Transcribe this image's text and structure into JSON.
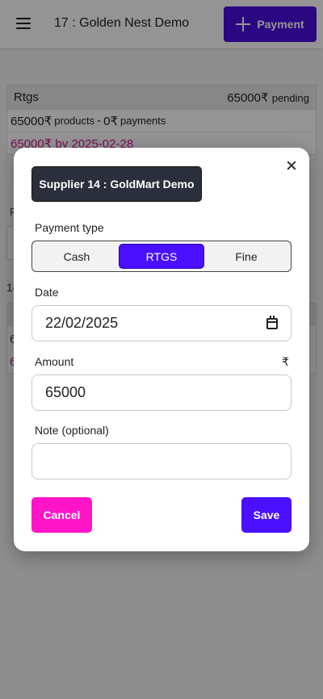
{
  "appbar": {
    "title": "17 : Golden Nest Demo",
    "payment_button_label": "Payment"
  },
  "summary_card": {
    "method": "Rtgs",
    "amount": "65000₹",
    "status": "pending",
    "products_amount": "65000₹",
    "products_label": "products",
    "separator": "-",
    "payments_amount": "0₹",
    "payments_label": "payments",
    "due_line": "65000₹ by 2025-02-28"
  },
  "background_fragments": {
    "f": "F",
    "count": "14",
    "row_value": "6",
    "row_value2": "6"
  },
  "modal": {
    "supplier": "Supplier 14 : GoldMart Demo",
    "payment_type_label": "Payment type",
    "payment_types": [
      "Cash",
      "RTGS",
      "Fine"
    ],
    "selected_payment_type": "RTGS",
    "date_label": "Date",
    "date_value": "22/02/2025",
    "amount_label": "Amount",
    "amount_unit": "₹",
    "amount_value": "65000",
    "note_label": "Note (optional)",
    "note_value": "",
    "cancel_label": "Cancel",
    "save_label": "Save"
  },
  "colors": {
    "primary": "#4a0fff",
    "cancel": "#ff14c8",
    "supplier_chip": "#2a2f3b",
    "due_text": "#d0149a"
  },
  "icons": [
    "hamburger-icon",
    "plus-icon",
    "close-icon",
    "calendar-icon"
  ]
}
